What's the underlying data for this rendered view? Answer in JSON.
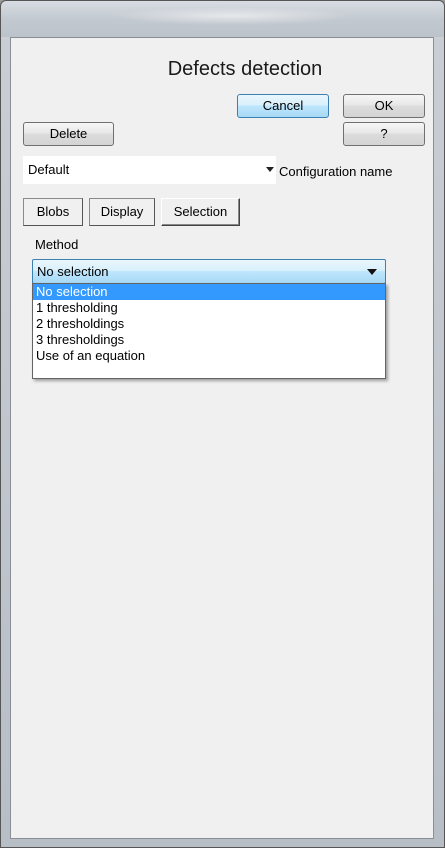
{
  "window": {
    "title": "Defects detection"
  },
  "buttons": {
    "cancel": "Cancel",
    "ok": "OK",
    "delete": "Delete",
    "help": "?"
  },
  "configuration": {
    "selected": "Default",
    "label": "Configuration name"
  },
  "tabs": [
    {
      "label": "Blobs"
    },
    {
      "label": "Display"
    },
    {
      "label": "Selection"
    }
  ],
  "method": {
    "label": "Method",
    "selected": "No selection",
    "options": [
      "No selection",
      "1 thresholding",
      "2 thresholdings",
      "3 thresholdings",
      "Use of an equation"
    ]
  },
  "colors": {
    "highlight": "#3399ff",
    "client_bg": "#f0f0f0",
    "default_button": "#bee6fd"
  }
}
